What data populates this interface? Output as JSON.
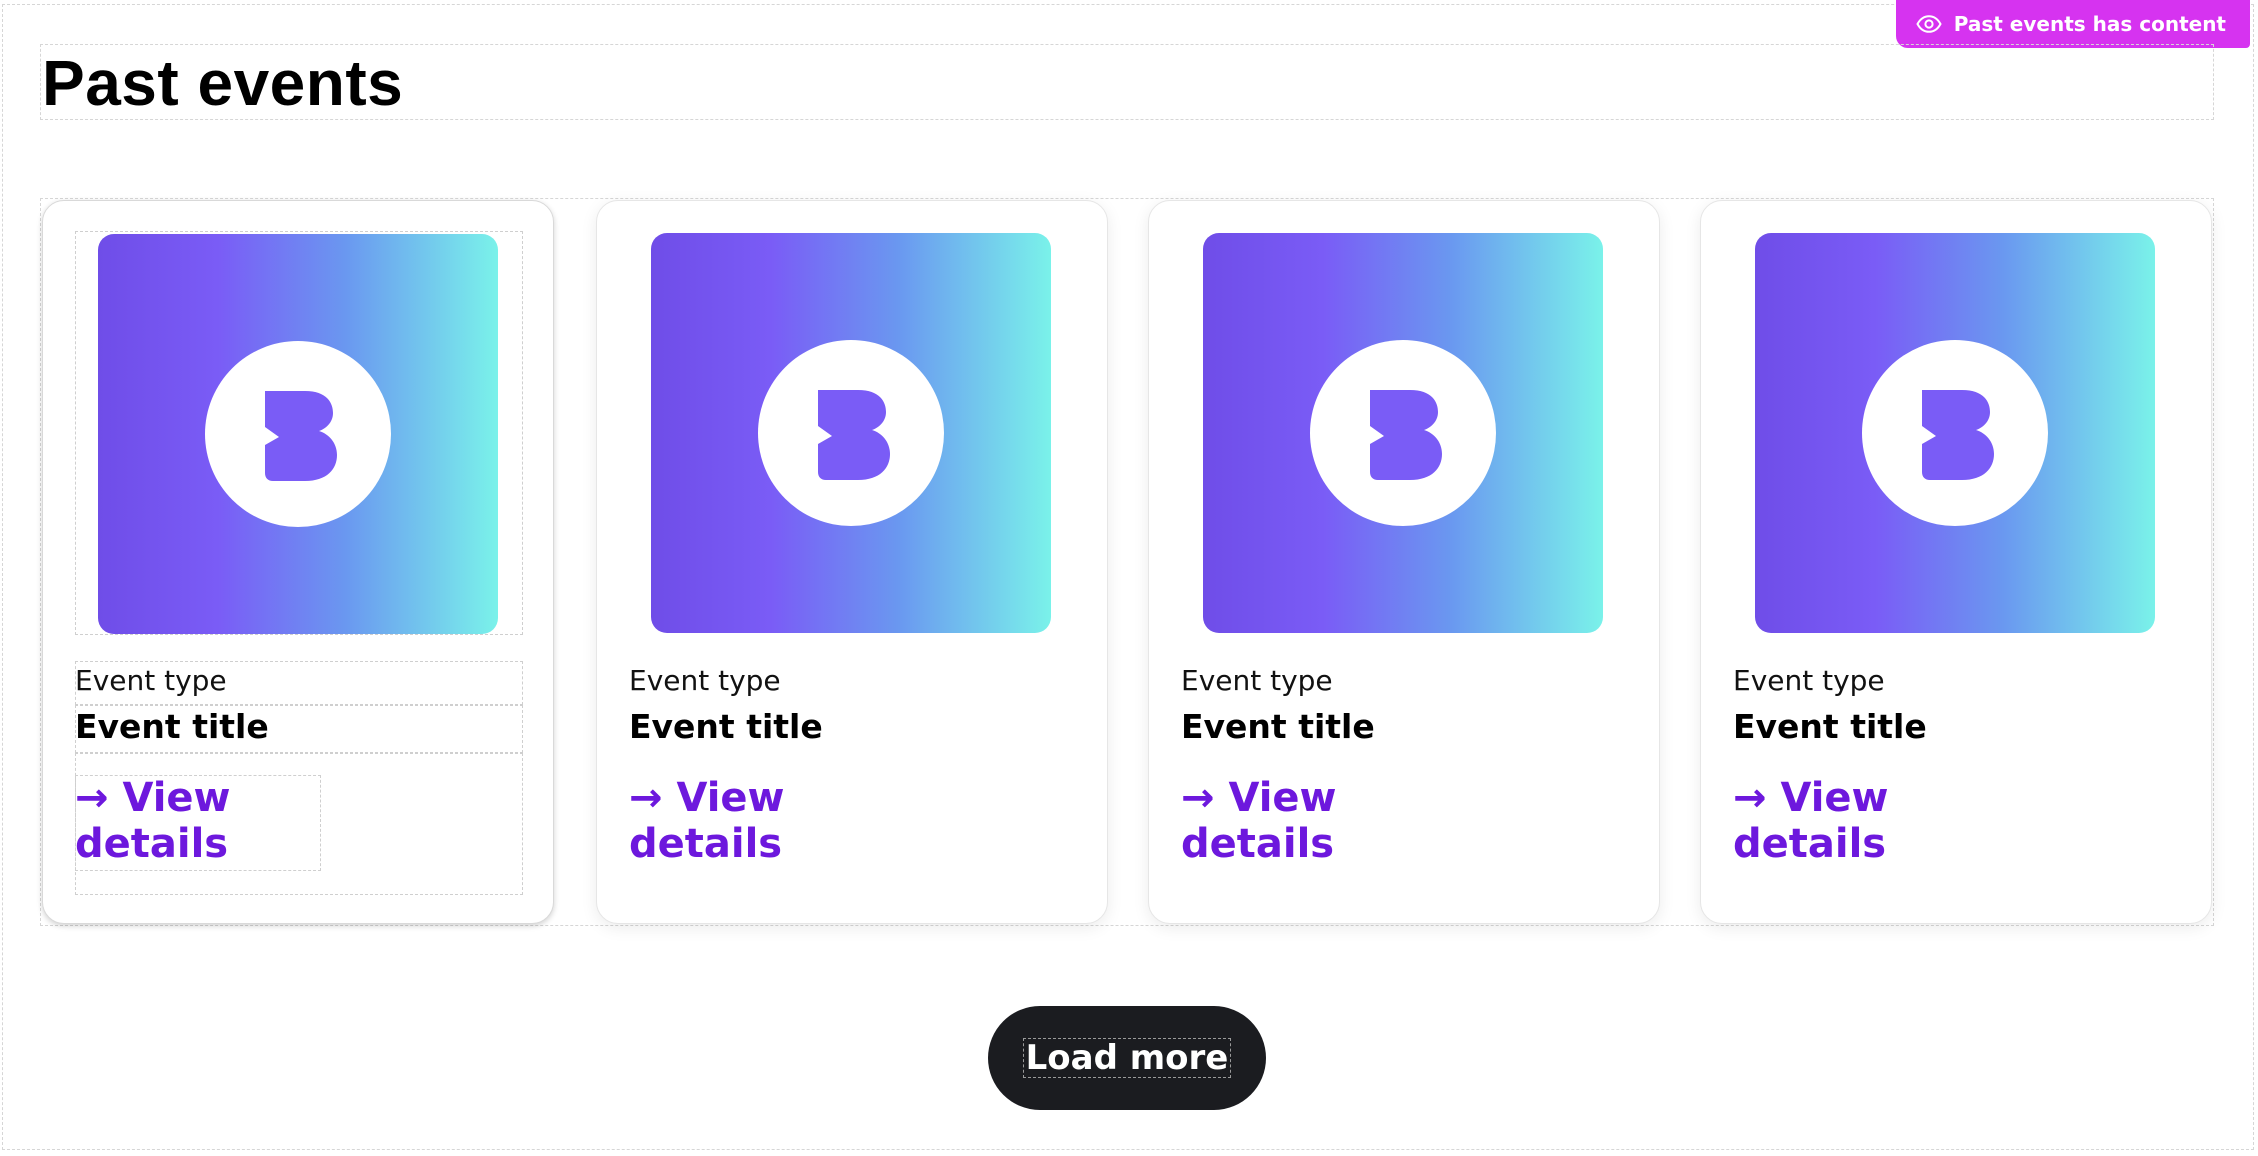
{
  "badge": {
    "label": "Past events has content",
    "icon": "eye-icon",
    "color": "#d633f0"
  },
  "section": {
    "title": "Past events"
  },
  "events": [
    {
      "type": "Event type",
      "title": "Event title",
      "link": "→ View details",
      "image_icon": "brand-b-logo-icon"
    },
    {
      "type": "Event type",
      "title": "Event title",
      "link": "→ View details",
      "image_icon": "brand-b-logo-icon"
    },
    {
      "type": "Event type",
      "title": "Event title",
      "link": "→ View details",
      "image_icon": "brand-b-logo-icon"
    },
    {
      "type": "Event type",
      "title": "Event title",
      "link": "→ View details",
      "image_icon": "brand-b-logo-icon"
    }
  ],
  "load_more": {
    "label": "Load more"
  },
  "colors": {
    "link": "#6d18dd",
    "button_bg": "#1b1c20",
    "gradient_start": "#6f4de8",
    "gradient_end": "#7af2ea"
  }
}
